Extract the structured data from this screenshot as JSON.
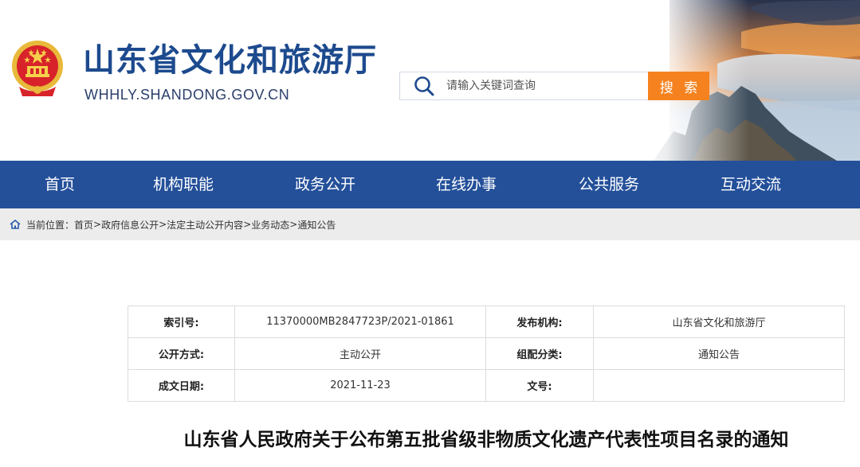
{
  "header": {
    "site_title": "山东省文化和旅游厅",
    "site_domain": "WHHLY.SHANDONG.GOV.CN",
    "search": {
      "placeholder": "请输入关键词查询",
      "button_label": "搜 索"
    }
  },
  "nav": {
    "items": [
      {
        "label": "首页"
      },
      {
        "label": "机构职能"
      },
      {
        "label": "政务公开"
      },
      {
        "label": "在线办事"
      },
      {
        "label": "公共服务"
      },
      {
        "label": "互动交流"
      }
    ]
  },
  "breadcrumb": {
    "prefix": "当前位置：",
    "items": [
      "首页",
      "政府信息公开",
      "法定主动公开内容",
      "业务动态",
      "通知公告"
    ],
    "separator": ">"
  },
  "meta": {
    "rows": [
      {
        "label1": "索引号:",
        "value1": "11370000MB2847723P/2021-01861",
        "label2": "发布机构:",
        "value2": "山东省文化和旅游厅"
      },
      {
        "label1": "公开方式:",
        "value1": "主动公开",
        "label2": "组配分类:",
        "value2": "通知公告"
      },
      {
        "label1": "成文日期:",
        "value1": "2021-11-23",
        "label2": "文号:",
        "value2": ""
      }
    ]
  },
  "article": {
    "title": "山东省人民政府关于公布第五批省级非物质文化遗产代表性项目名录的通知"
  },
  "colors": {
    "brand_blue": "#24509a",
    "title_blue": "#1d4a8e",
    "search_orange": "#f5821f",
    "breadcrumb_bg": "#ececec"
  }
}
